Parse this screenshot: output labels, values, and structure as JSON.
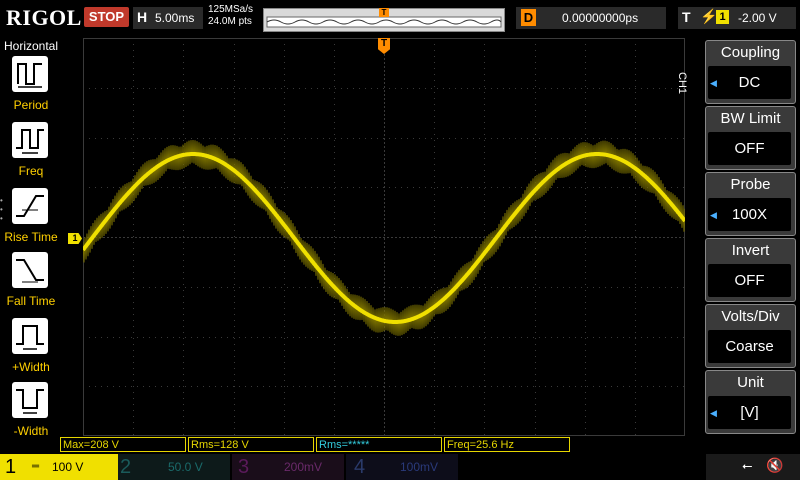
{
  "header": {
    "logo": "RIGOL",
    "run_state": "STOP",
    "horizontal_letter": "H",
    "timebase": "5.00ms",
    "sample_rate": "125MSa/s",
    "memory_depth": "24.0M pts",
    "delay_letter": "D",
    "delay_value": "0.00000000ps",
    "trigger_letter": "T",
    "trigger_source": "1",
    "trigger_level": "-2.00 V",
    "trigger_marker": "T"
  },
  "left_panel": {
    "title": "Horizontal",
    "items": [
      {
        "label": "Period"
      },
      {
        "label": "Freq"
      },
      {
        "label": "Rise Time"
      },
      {
        "label": "Fall Time"
      },
      {
        "label": "+Width"
      },
      {
        "label": "-Width"
      }
    ]
  },
  "right_panel": {
    "channel_tag": "CH1",
    "items": [
      {
        "label": "Coupling",
        "value": "DC"
      },
      {
        "label": "BW Limit",
        "value": "OFF"
      },
      {
        "label": "Probe",
        "value": "100X"
      },
      {
        "label": "Invert",
        "value": "OFF"
      },
      {
        "label": "Volts/Div",
        "value": "Coarse"
      },
      {
        "label": "Unit",
        "value": "[V]"
      }
    ]
  },
  "markers": {
    "ch1_marker": "1"
  },
  "measurements": [
    {
      "text": "Max=208 V"
    },
    {
      "text": "Rms=128 V"
    },
    {
      "text": "Rms=*****"
    },
    {
      "text": "Freq=25.6 Hz"
    }
  ],
  "channels": [
    {
      "num": "1",
      "scale": "100 V",
      "color": "#f0e000"
    },
    {
      "num": "2",
      "scale": "50.0 V",
      "color": "#00d0d0"
    },
    {
      "num": "3",
      "scale": "200mV",
      "color": "#e040e0"
    },
    {
      "num": "4",
      "scale": "100mV",
      "color": "#3080ff"
    }
  ],
  "colors": {
    "trace": "#f0e000",
    "grid": "#3a3a3a",
    "trigger": "#ff8c00",
    "accent_blue": "#4ab0ff"
  }
}
